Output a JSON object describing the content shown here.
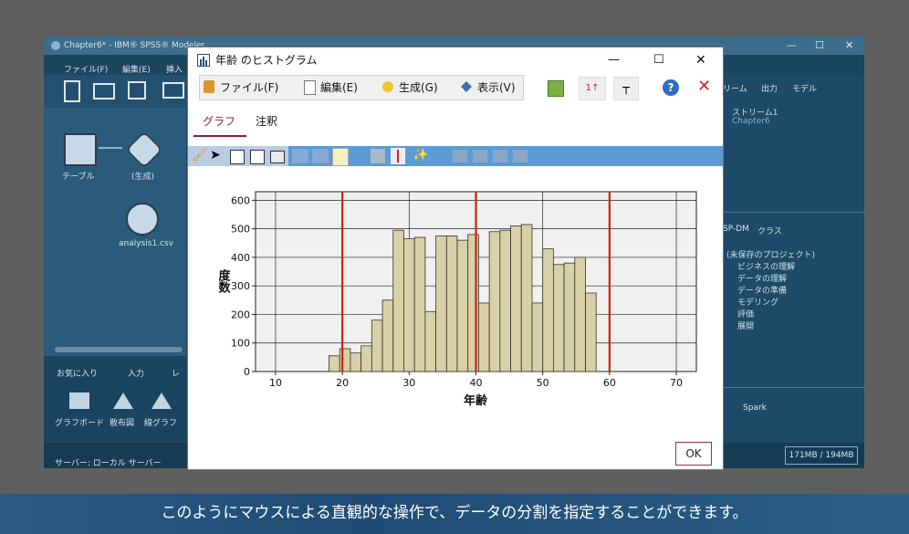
{
  "background_app": {
    "title": "Chapter6* - IBM® SPSS® Modeler",
    "menu": [
      "ファイル(F)",
      "編集(E)",
      "挿入"
    ],
    "nodes": {
      "table_label": "テーブル",
      "generated_label": "(生成)",
      "source_label": "analysis1.csv"
    },
    "palette_tabs": [
      "お気に入り",
      "入力",
      "レ"
    ],
    "palette_items": [
      "グラフボード",
      "散布図",
      "線グラフ"
    ],
    "status_text": "サーバー: ローカル サーバー",
    "memory": "171MB / 194MB",
    "right_tabs": [
      "リーム",
      "出力",
      "モデル"
    ],
    "stream_item": "ストリーム1",
    "stream_sub": "Chapter6",
    "crisp_tabs": [
      "SP-DM",
      "クラス"
    ],
    "project_tree": [
      "(未保存のプロジェクト)",
      "ビジネスの理解",
      "データの理解",
      "データの準備",
      "モデリング",
      "評価",
      "展開"
    ],
    "spark_label": "Spark"
  },
  "dialog": {
    "title": "年齢 のヒストグラム",
    "menu": [
      "ファイル(F)",
      "編集(E)",
      "生成(G)",
      "表示(V)"
    ],
    "tabs": [
      "グラフ",
      "注釈"
    ],
    "ok_label": "OK"
  },
  "chart_data": {
    "type": "bar",
    "xlabel": "年齢",
    "ylabel": "度数",
    "xlim": [
      7,
      73
    ],
    "ylim": [
      0,
      630
    ],
    "xticks": [
      10,
      20,
      30,
      40,
      50,
      60,
      70
    ],
    "yticks": [
      0,
      100,
      200,
      300,
      400,
      500,
      600
    ],
    "bin_start": 18,
    "bin_width": 1.6,
    "values": [
      55,
      80,
      65,
      90,
      180,
      250,
      495,
      465,
      470,
      210,
      475,
      475,
      460,
      480,
      240,
      490,
      495,
      510,
      515,
      240,
      430,
      375,
      380,
      400,
      275
    ],
    "split_lines": [
      20,
      40,
      60
    ],
    "bar_color": "#d8d0a6",
    "split_color": "#cc2211",
    "grid": true
  },
  "subtitle": "このようにマウスによる直観的な操作で、データの分割を指定することができます。"
}
